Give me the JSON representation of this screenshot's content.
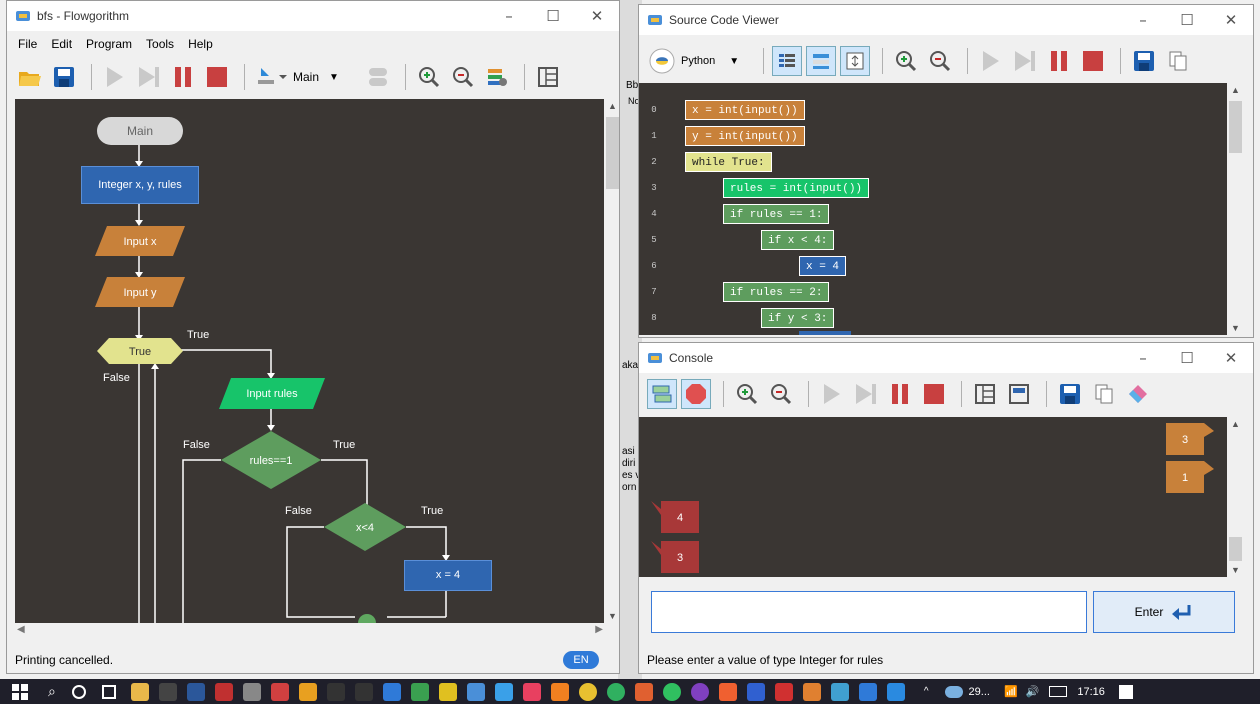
{
  "flowgorithm": {
    "title": "bfs - Flowgorithm",
    "menu": [
      "File",
      "Edit",
      "Program",
      "Tools",
      "Help"
    ],
    "function_select": "Main",
    "status": "Printing cancelled.",
    "lang_badge": "EN",
    "flow": {
      "main": "Main",
      "declare": "Integer x, y, rules",
      "input_x": "Input x",
      "input_y": "Input y",
      "while": "True",
      "while_true": "True",
      "while_false": "False",
      "input_rules": "Input rules",
      "if1": "rules==1",
      "if1_true": "True",
      "if1_false": "False",
      "if2": "x<4",
      "if2_true": "True",
      "if2_false": "False",
      "assign": "x = 4"
    }
  },
  "source_viewer": {
    "title": "Source Code Viewer",
    "language": "Python",
    "lines": [
      {
        "n": "0",
        "text": "x = int(input())"
      },
      {
        "n": "1",
        "text": "y = int(input())"
      },
      {
        "n": "2",
        "text": "while True:"
      },
      {
        "n": "3",
        "text": "rules = int(input())"
      },
      {
        "n": "4",
        "text": "if rules == 1:"
      },
      {
        "n": "5",
        "text": "if x < 4:"
      },
      {
        "n": "6",
        "text": "x = 4"
      },
      {
        "n": "7",
        "text": "if rules == 2:"
      },
      {
        "n": "8",
        "text": "if y < 3:"
      }
    ]
  },
  "console": {
    "title": "Console",
    "outputs": [
      "3",
      "1"
    ],
    "inputs": [
      "4",
      "3"
    ],
    "input_value": "",
    "enter_label": "Enter",
    "status": "Please enter a value of type Integer for rules"
  },
  "background": {
    "fragments": [
      "Bb",
      "Nor",
      "aka",
      "asi",
      "diri",
      "es v",
      "orn"
    ]
  },
  "taskbar": {
    "weather": "29...",
    "time": "17:16"
  }
}
